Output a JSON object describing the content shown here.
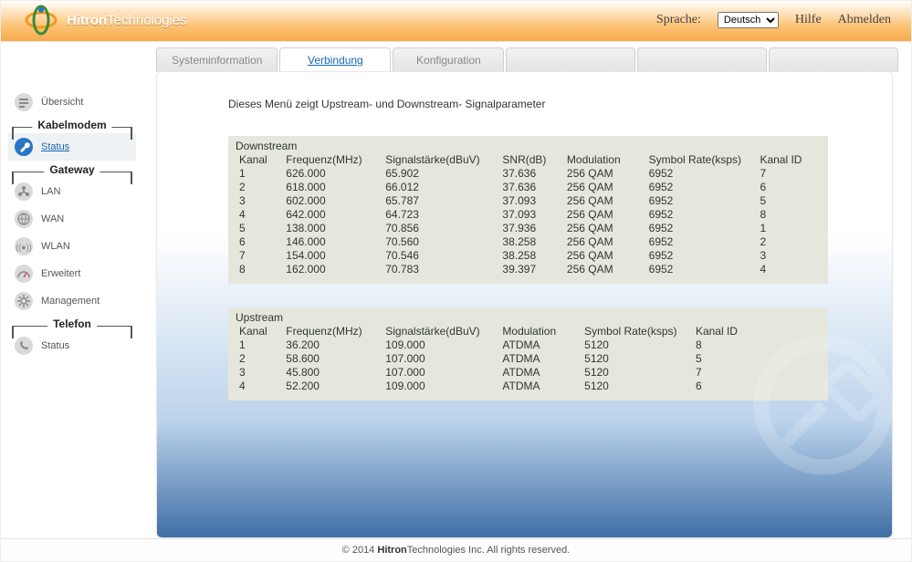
{
  "header": {
    "brand_strong": "Hitron",
    "brand_thin": "Technologies",
    "lang_label": "Sprache:",
    "lang_value": "Deutsch",
    "help": "Hilfe",
    "logout": "Abmelden"
  },
  "tabs": [
    {
      "label": "Systeminformation",
      "active": false
    },
    {
      "label": "Verbindung",
      "active": true
    },
    {
      "label": "Konfiguration",
      "active": false
    },
    {
      "label": "",
      "active": false
    },
    {
      "label": "",
      "active": false
    },
    {
      "label": "",
      "active": false
    }
  ],
  "sidebar": {
    "top": [
      {
        "id": "uebersicht",
        "label": "Übersicht",
        "icon": "overview-icon"
      }
    ],
    "sections": [
      {
        "title": "Kabelmodem",
        "items": [
          {
            "id": "km-status",
            "label": "Status",
            "icon": "wrench-icon",
            "selected": true
          }
        ]
      },
      {
        "title": "Gateway",
        "items": [
          {
            "id": "lan",
            "label": "LAN",
            "icon": "lan-icon"
          },
          {
            "id": "wan",
            "label": "WAN",
            "icon": "globe-icon"
          },
          {
            "id": "wlan",
            "label": "WLAN",
            "icon": "wifi-icon"
          },
          {
            "id": "erw",
            "label": "Erweitert",
            "icon": "gauge-icon"
          },
          {
            "id": "mgmt",
            "label": "Management",
            "icon": "gear-icon"
          }
        ]
      },
      {
        "title": "Telefon",
        "items": [
          {
            "id": "tel-status",
            "label": "Status",
            "icon": "phone-icon"
          }
        ]
      }
    ]
  },
  "page": {
    "description": "Dieses Menü zeigt Upstream- und Downstream- Signalparameter",
    "downstream": {
      "title": "Downstream",
      "headers": [
        "Kanal",
        "Frequenz(MHz)",
        "Signalstärke(dBuV)",
        "SNR(dB)",
        "Modulation",
        "Symbol Rate(ksps)",
        "Kanal ID"
      ],
      "rows": [
        [
          "1",
          "626.000",
          "65.902",
          "37.636",
          "256 QAM",
          "6952",
          "7"
        ],
        [
          "2",
          "618.000",
          "66.012",
          "37.636",
          "256 QAM",
          "6952",
          "6"
        ],
        [
          "3",
          "602.000",
          "65.787",
          "37.093",
          "256 QAM",
          "6952",
          "5"
        ],
        [
          "4",
          "642.000",
          "64.723",
          "37.093",
          "256 QAM",
          "6952",
          "8"
        ],
        [
          "5",
          "138.000",
          "70.856",
          "37.936",
          "256 QAM",
          "6952",
          "1"
        ],
        [
          "6",
          "146.000",
          "70.560",
          "38.258",
          "256 QAM",
          "6952",
          "2"
        ],
        [
          "7",
          "154.000",
          "70.546",
          "38.258",
          "256 QAM",
          "6952",
          "3"
        ],
        [
          "8",
          "162.000",
          "70.783",
          "39.397",
          "256 QAM",
          "6952",
          "4"
        ]
      ]
    },
    "upstream": {
      "title": "Upstream",
      "headers": [
        "Kanal",
        "Frequenz(MHz)",
        "Signalstärke(dBuV)",
        "Modulation",
        "Symbol Rate(ksps)",
        "Kanal ID"
      ],
      "rows": [
        [
          "1",
          "36.200",
          "109.000",
          "ATDMA",
          "5120",
          "8"
        ],
        [
          "2",
          "58.600",
          "107.000",
          "ATDMA",
          "5120",
          "5"
        ],
        [
          "3",
          "45.800",
          "107.000",
          "ATDMA",
          "5120",
          "7"
        ],
        [
          "4",
          "52.200",
          "109.000",
          "ATDMA",
          "5120",
          "6"
        ]
      ]
    }
  },
  "footer": {
    "copy_prefix": "© 2014 ",
    "brand_strong": "Hitron",
    "brand_thin": "Technologies",
    "copy_suffix": " Inc.  All rights reserved."
  }
}
